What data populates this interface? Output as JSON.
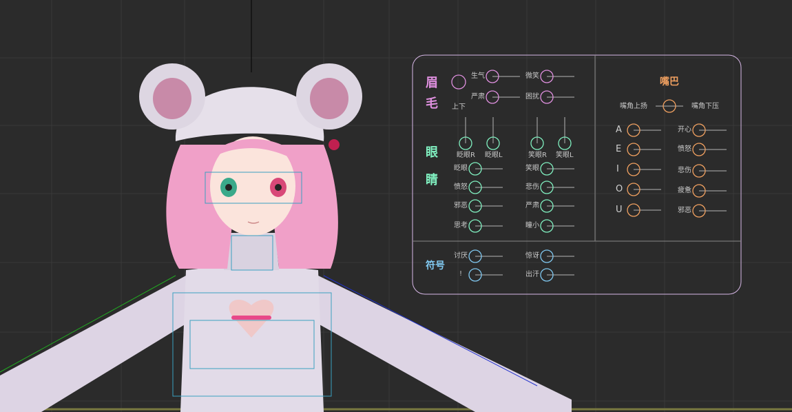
{
  "colors": {
    "viewport_bg": "#2b2b2b",
    "grid": "#3a3a3a",
    "panel_border": "#d8b8e8",
    "brow": "#e090e0",
    "eye": "#80f0c0",
    "mouth": "#f0a060",
    "symbol": "#80c8f0"
  },
  "brow": {
    "title_1": "眉",
    "title_2": "毛",
    "updown_label": "上下",
    "sliders": [
      "生气",
      "严肃",
      "微笑",
      "困扰"
    ]
  },
  "eye": {
    "title_1": "眼",
    "title_2": "睛",
    "vertical_sliders": [
      "眨眼R",
      "眨眼L",
      "笑眼R",
      "笑眼L"
    ],
    "sliders": [
      "眨眼",
      "愤怒",
      "邪恶",
      "思考",
      "笑眼",
      "悲伤",
      "严肃",
      "瞳小"
    ]
  },
  "mouth": {
    "title": "嘴巴",
    "corner_up": "嘴角上扬",
    "corner_down": "嘴角下压",
    "vowels": [
      "A",
      "E",
      "I",
      "O",
      "U"
    ],
    "sliders": [
      "开心",
      "愤怒",
      "悲伤",
      "疲惫",
      "邪恶"
    ]
  },
  "symbol": {
    "title": "符号",
    "sliders": [
      "讨厌",
      "!",
      "惊讶",
      "出汗"
    ]
  }
}
